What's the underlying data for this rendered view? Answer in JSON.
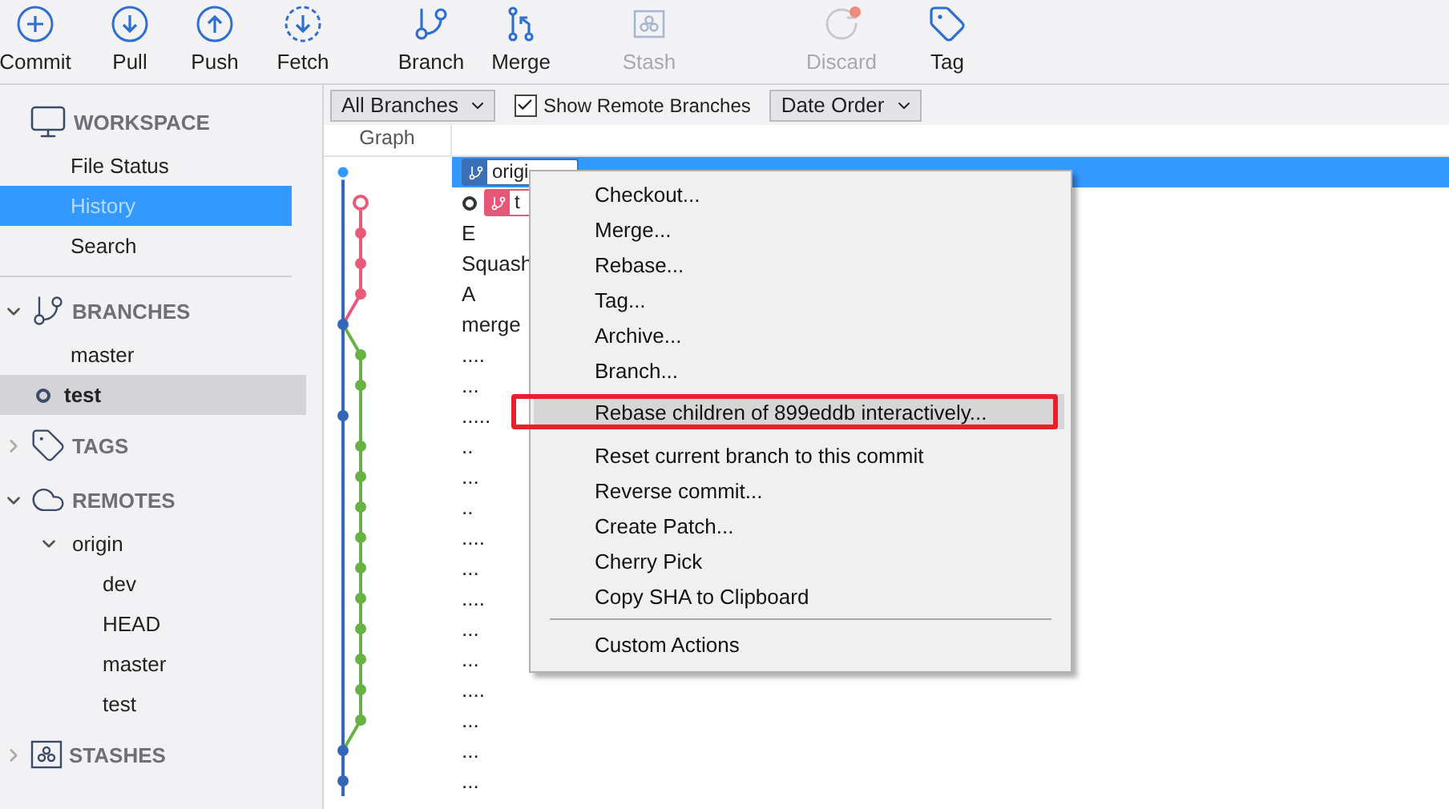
{
  "toolbar": [
    {
      "kind": "commit",
      "label": "Commit",
      "disabled": false
    },
    {
      "kind": "pull",
      "label": "Pull",
      "disabled": false
    },
    {
      "kind": "push",
      "label": "Push",
      "disabled": false
    },
    {
      "kind": "fetch",
      "label": "Fetch",
      "disabled": false
    },
    {
      "kind": "branch",
      "label": "Branch",
      "disabled": false
    },
    {
      "kind": "merge",
      "label": "Merge",
      "disabled": false
    },
    {
      "kind": "stash",
      "label": "Stash",
      "disabled": true
    },
    {
      "kind": "discard",
      "label": "Discard",
      "disabled": true
    },
    {
      "kind": "tag",
      "label": "Tag",
      "disabled": false
    }
  ],
  "sidebar": [
    {
      "kind": "workspace",
      "title": "WORKSPACE",
      "items": [
        {
          "label": "File Status",
          "selected": false
        },
        {
          "label": "History",
          "selected": true
        },
        {
          "label": "Search",
          "selected": false
        }
      ]
    },
    {
      "kind": "branches",
      "title": "BRANCHES",
      "expanded": true,
      "items": [
        {
          "label": "master",
          "current": false,
          "selected": false
        },
        {
          "label": "test",
          "current": true,
          "selected": true
        }
      ]
    },
    {
      "kind": "tags",
      "title": "TAGS",
      "expanded": false
    },
    {
      "kind": "remotes",
      "title": "REMOTES",
      "expanded": true,
      "items": [
        {
          "label": "origin",
          "expanded": true,
          "children": [
            {
              "label": "dev"
            },
            {
              "label": "HEAD"
            },
            {
              "label": "master"
            },
            {
              "label": "test"
            }
          ]
        }
      ]
    },
    {
      "kind": "stashes",
      "title": "STASHES",
      "expanded": false
    }
  ],
  "filter_bar": {
    "branch_filter": "All Branches",
    "show_remote": {
      "label": "Show Remote Branches",
      "checked": true
    },
    "order": "Date Order"
  },
  "table": {
    "columns": [
      "Graph"
    ],
    "rows": [
      {
        "message": "",
        "selected": true,
        "head": false,
        "refs": [
          {
            "label": "origi",
            "color": "#3a6eb5"
          }
        ]
      },
      {
        "message": "",
        "selected": false,
        "head": true,
        "refs": [
          {
            "label": "t",
            "color": "#e8577a"
          }
        ]
      },
      {
        "message": "E",
        "selected": false,
        "head": false
      },
      {
        "message": "Squash",
        "selected": false,
        "head": false
      },
      {
        "message": "A",
        "selected": false,
        "head": false
      },
      {
        "message": "merge",
        "selected": false,
        "head": false
      },
      {
        "message": "....",
        "selected": false,
        "head": false
      },
      {
        "message": "...",
        "selected": false,
        "head": false
      },
      {
        "message": ".....",
        "selected": false,
        "head": false
      },
      {
        "message": "..",
        "selected": false,
        "head": false
      },
      {
        "message": "...",
        "selected": false,
        "head": false
      },
      {
        "message": "..",
        "selected": false,
        "head": false
      },
      {
        "message": "....",
        "selected": false,
        "head": false
      },
      {
        "message": "...",
        "selected": false,
        "head": false
      },
      {
        "message": "....",
        "selected": false,
        "head": false
      },
      {
        "message": "...",
        "selected": false,
        "head": false
      },
      {
        "message": "...",
        "selected": false,
        "head": false
      },
      {
        "message": "....",
        "selected": false,
        "head": false
      },
      {
        "message": "...",
        "selected": false,
        "head": false
      },
      {
        "message": "...",
        "selected": false,
        "head": false
      },
      {
        "message": "...",
        "selected": false,
        "head": false
      }
    ]
  },
  "context_menu": {
    "groups": [
      [
        {
          "label": "Checkout...",
          "selected": false
        },
        {
          "label": "Merge...",
          "selected": false
        },
        {
          "label": "Rebase...",
          "selected": false
        },
        {
          "label": "Tag...",
          "selected": false
        },
        {
          "label": "Archive...",
          "selected": false
        },
        {
          "label": "Branch...",
          "selected": false
        },
        {
          "label": "Rebase children of 899eddb interactively...",
          "selected": true,
          "annotated": true
        },
        {
          "label": "Reset current branch to this commit",
          "selected": false
        },
        {
          "label": "Reverse commit...",
          "selected": false
        },
        {
          "label": "Create Patch...",
          "selected": false
        },
        {
          "label": "Cherry Pick",
          "selected": false
        },
        {
          "label": "Copy SHA to Clipboard",
          "selected": false
        }
      ],
      [
        {
          "label": "Custom Actions",
          "selected": false
        }
      ]
    ]
  }
}
